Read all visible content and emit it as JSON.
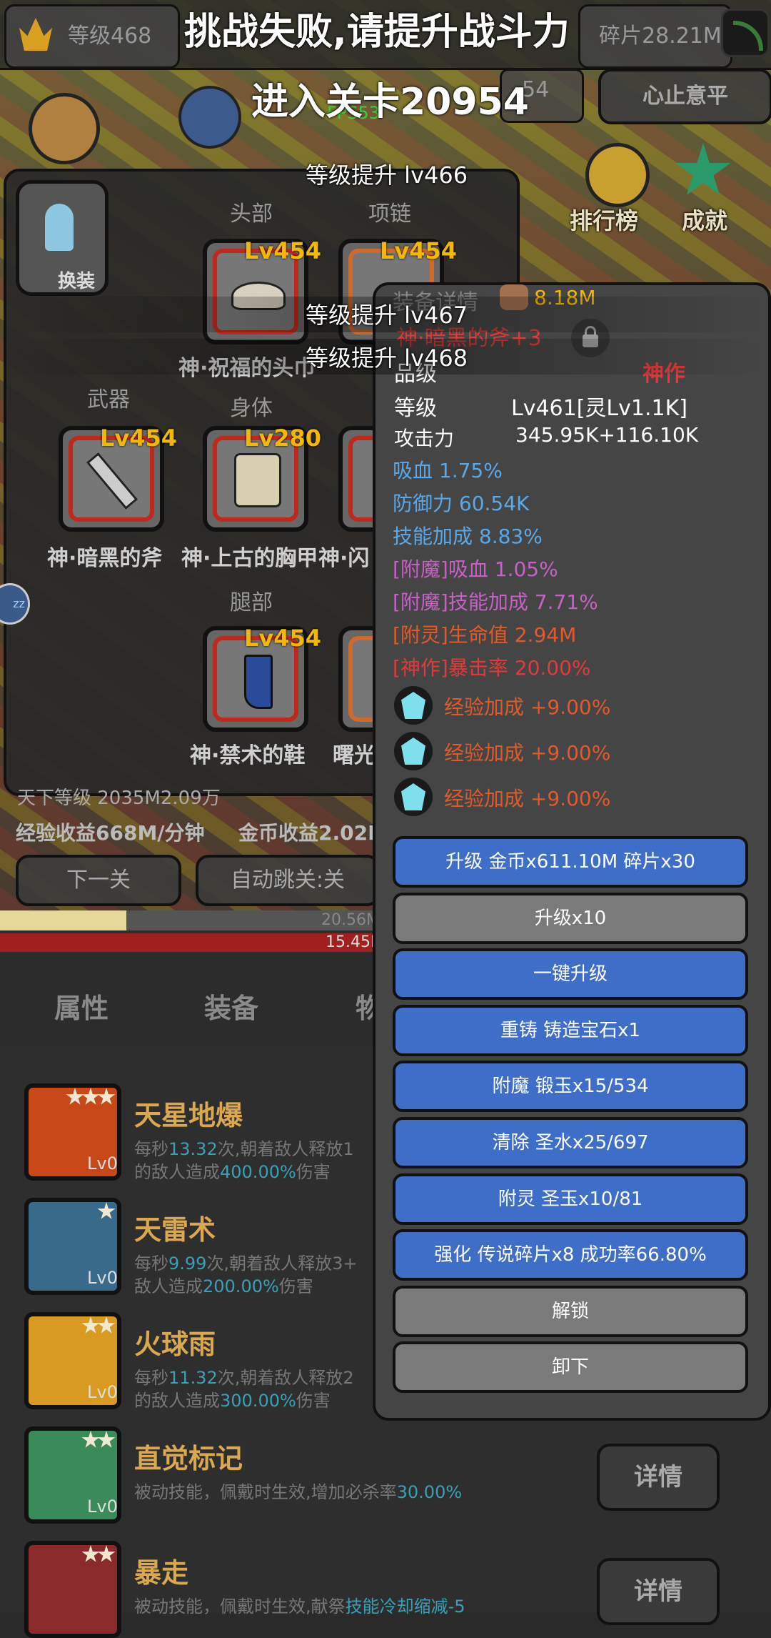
{
  "header": {
    "level": "等级468",
    "fragments": "碎片28.21M",
    "stage_number_partial": "54",
    "calm_button": "心止意平",
    "fps": "FPS53"
  },
  "messages": {
    "fail": "挑战失败,请提升战斗力",
    "enter_stage": "进入关卡20954",
    "levelups": [
      "等级提升 lv466",
      "等级提升 lv467",
      "等级提升 lv468"
    ]
  },
  "right_menu": {
    "ranking": "排行榜",
    "achievement": "成就"
  },
  "equip_panel": {
    "swap_button": "换装",
    "slots": {
      "head": {
        "label": "头部",
        "level": "Lv454",
        "name": "神·祝福的头巾"
      },
      "necklace": {
        "label": "项链",
        "level": "Lv454"
      },
      "weapon": {
        "label": "武器",
        "level": "Lv454",
        "name": "神·暗黑的斧"
      },
      "body": {
        "label": "身体",
        "level": "Lv280",
        "name": "神·上古的胸甲"
      },
      "flash_partial": "神·闪",
      "legs": {
        "label": "腿部",
        "level": "Lv454",
        "name": "神·禁术的鞋"
      },
      "dawn_partial": "曙光"
    }
  },
  "stats_strip": {
    "world_level_partial": "天下等级 2035M2.09万",
    "exp_income": "经验收益668M/分钟",
    "gold_income": "金币收益2.02M",
    "next_stage_button": "下一关",
    "auto_skip_button": "自动跳关:关",
    "bar_yellow_value": "20.56M",
    "bar_red_value": "15.45M"
  },
  "tabs": [
    "属性",
    "装备",
    "物"
  ],
  "detail_panel": {
    "header_partial": "装备详情",
    "power": "8.18M",
    "item_name": "神·暗黑的斧+3",
    "quality_label": "品级",
    "quality_value": "神作",
    "level_label": "等级",
    "level_value": "Lv461[灵Lv1.1K]",
    "attack_label": "攻击力",
    "attack_value": "345.95K+116.10K",
    "attrs": [
      {
        "text": "吸血 1.75%",
        "color": "#5aa8e8"
      },
      {
        "text": "防御力 60.54K",
        "color": "#5aa8e8"
      },
      {
        "text": "技能加成 8.83%",
        "color": "#5aa8e8"
      },
      {
        "text": "[附魔]吸血 1.05%",
        "color": "#c860c8"
      },
      {
        "text": "[附魔]技能加成 7.71%",
        "color": "#c860c8"
      },
      {
        "text": "[附灵]生命值 2.94M",
        "color": "#e05a2a"
      },
      {
        "text": "[神作]暴击率 20.00%",
        "color": "#e03a3a"
      }
    ],
    "gems": [
      "经验加成 +9.00%",
      "经验加成 +9.00%",
      "经验加成 +9.00%"
    ],
    "buttons": [
      {
        "label": "升级 金币x611.10M 碎片x30",
        "style": "blue"
      },
      {
        "label": "升级x10",
        "style": "gray"
      },
      {
        "label": "一键升级",
        "style": "blue"
      },
      {
        "label": "重铸 铸造宝石x1",
        "style": "blue"
      },
      {
        "label": "附魔 锻玉x15/534",
        "style": "blue"
      },
      {
        "label": "清除 圣水x25/697",
        "style": "blue"
      },
      {
        "label": "附灵 圣玉x10/81",
        "style": "blue"
      },
      {
        "label": "强化 传说碎片x8 成功率66.80%",
        "style": "blue"
      },
      {
        "label": "解锁",
        "style": "gray"
      },
      {
        "label": "卸下",
        "style": "gray"
      }
    ]
  },
  "skills": [
    {
      "name": "天星地爆",
      "lv": "Lv0",
      "stars": 3,
      "desc1a": "每秒",
      "desc1b": "13.32",
      "desc1c": "次,朝着敌人释放1",
      "desc2a": "的敌人造成",
      "desc2b": "400.00%",
      "desc2c": "伤害"
    },
    {
      "name": "天雷术",
      "lv": "Lv0",
      "stars": 1,
      "desc1a": "每秒",
      "desc1b": "9.99",
      "desc1c": "次,朝着敌人释放3+",
      "desc2a": "敌人造成",
      "desc2b": "200.00%",
      "desc2c": "伤害"
    },
    {
      "name": "火球雨",
      "lv": "Lv0",
      "stars": 2,
      "desc1a": "每秒",
      "desc1b": "11.32",
      "desc1c": "次,朝着敌人释放2",
      "desc2a": "的敌人造成",
      "desc2b": "300.00%",
      "desc2c": "伤害"
    },
    {
      "name": "直觉标记",
      "lv": "Lv0",
      "stars": 2,
      "desc1a": "被动技能，佩戴时生效,增加必杀率",
      "desc1b": "30.00%",
      "desc1c": "",
      "desc2a": "",
      "desc2b": "",
      "desc2c": ""
    },
    {
      "name": "暴走",
      "lv": "",
      "stars": 2,
      "desc1a": "被动技能，佩戴时生效,献祭",
      "desc1b": "技能冷却缩减-5",
      "desc1c": "",
      "desc2a": "",
      "desc2b": "",
      "desc2c": ""
    }
  ],
  "detail_button": "详情",
  "side_badge": "zz"
}
